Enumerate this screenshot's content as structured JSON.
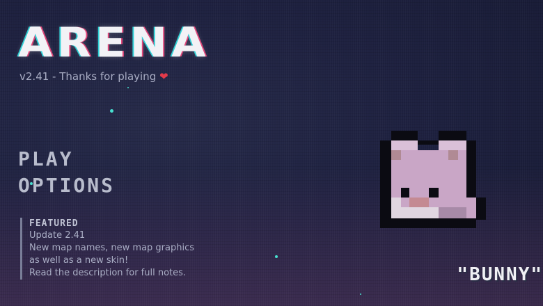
{
  "game": {
    "title": "ARENA",
    "version": "v2.41",
    "thanks": " - Thanks for playing",
    "heart_icon": "heart-icon"
  },
  "menu": {
    "items": [
      {
        "label": "PLAY"
      },
      {
        "label": "OPTIONS"
      }
    ]
  },
  "featured": {
    "heading": "FEATURED",
    "title": "Update 2.41",
    "lines": [
      "New map names, new map graphics",
      "as well as a new skin!",
      "Read the description for full notes."
    ]
  },
  "skin": {
    "name": "\"BUNNY\"",
    "icon": "pig-character-icon"
  },
  "colors": {
    "accent_cyan": "#48e0d0",
    "glitch_red": "#e0467a",
    "skin_pink": "#c9a6c6"
  }
}
